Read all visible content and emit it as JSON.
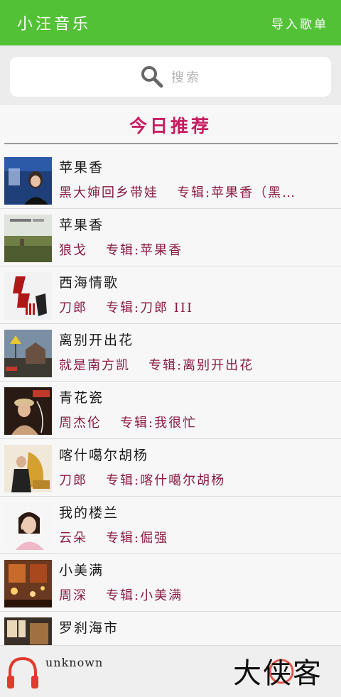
{
  "header": {
    "title": "小汪音乐",
    "import_label": "导入歌单"
  },
  "search": {
    "placeholder": "搜索"
  },
  "section": {
    "title": "今日推荐"
  },
  "songs": [
    {
      "name": "苹果香",
      "artist": "黑大婶回乡带娃",
      "album": "专辑:苹果香（黑…"
    },
    {
      "name": "苹果香",
      "artist": "狼戈",
      "album": "专辑:苹果香"
    },
    {
      "name": "西海情歌",
      "artist": "刀郎",
      "album": "专辑:刀郎 III"
    },
    {
      "name": "离别开出花",
      "artist": "就是南方凯",
      "album": "专辑:离别开出花"
    },
    {
      "name": "青花瓷",
      "artist": "周杰伦",
      "album": "专辑:我很忙"
    },
    {
      "name": "喀什噶尔胡杨",
      "artist": "刀郎",
      "album": "专辑:喀什噶尔胡杨"
    },
    {
      "name": "我的楼兰",
      "artist": "云朵",
      "album": "专辑:倔强"
    },
    {
      "name": "小美满",
      "artist": "周深",
      "album": "专辑:小美满"
    },
    {
      "name": "罗刹海市",
      "artist": "",
      "album": ""
    }
  ],
  "player": {
    "now_playing": "unknown"
  },
  "watermark": {
    "text": "大侠客"
  },
  "colors": {
    "accent": "#52c136",
    "section_title": "#c81c60",
    "meta_text": "#8a1a42",
    "player_icon": "#e03b2e"
  }
}
